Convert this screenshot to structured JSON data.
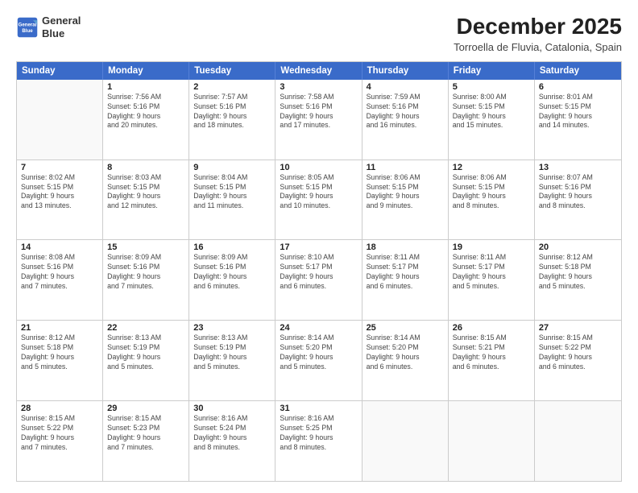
{
  "logo": {
    "line1": "General",
    "line2": "Blue"
  },
  "title": "December 2025",
  "subtitle": "Torroella de Fluvia, Catalonia, Spain",
  "header_days": [
    "Sunday",
    "Monday",
    "Tuesday",
    "Wednesday",
    "Thursday",
    "Friday",
    "Saturday"
  ],
  "weeks": [
    [
      {
        "day": "",
        "info": ""
      },
      {
        "day": "1",
        "info": "Sunrise: 7:56 AM\nSunset: 5:16 PM\nDaylight: 9 hours\nand 20 minutes."
      },
      {
        "day": "2",
        "info": "Sunrise: 7:57 AM\nSunset: 5:16 PM\nDaylight: 9 hours\nand 18 minutes."
      },
      {
        "day": "3",
        "info": "Sunrise: 7:58 AM\nSunset: 5:16 PM\nDaylight: 9 hours\nand 17 minutes."
      },
      {
        "day": "4",
        "info": "Sunrise: 7:59 AM\nSunset: 5:16 PM\nDaylight: 9 hours\nand 16 minutes."
      },
      {
        "day": "5",
        "info": "Sunrise: 8:00 AM\nSunset: 5:15 PM\nDaylight: 9 hours\nand 15 minutes."
      },
      {
        "day": "6",
        "info": "Sunrise: 8:01 AM\nSunset: 5:15 PM\nDaylight: 9 hours\nand 14 minutes."
      }
    ],
    [
      {
        "day": "7",
        "info": "Sunrise: 8:02 AM\nSunset: 5:15 PM\nDaylight: 9 hours\nand 13 minutes."
      },
      {
        "day": "8",
        "info": "Sunrise: 8:03 AM\nSunset: 5:15 PM\nDaylight: 9 hours\nand 12 minutes."
      },
      {
        "day": "9",
        "info": "Sunrise: 8:04 AM\nSunset: 5:15 PM\nDaylight: 9 hours\nand 11 minutes."
      },
      {
        "day": "10",
        "info": "Sunrise: 8:05 AM\nSunset: 5:15 PM\nDaylight: 9 hours\nand 10 minutes."
      },
      {
        "day": "11",
        "info": "Sunrise: 8:06 AM\nSunset: 5:15 PM\nDaylight: 9 hours\nand 9 minutes."
      },
      {
        "day": "12",
        "info": "Sunrise: 8:06 AM\nSunset: 5:15 PM\nDaylight: 9 hours\nand 8 minutes."
      },
      {
        "day": "13",
        "info": "Sunrise: 8:07 AM\nSunset: 5:16 PM\nDaylight: 9 hours\nand 8 minutes."
      }
    ],
    [
      {
        "day": "14",
        "info": "Sunrise: 8:08 AM\nSunset: 5:16 PM\nDaylight: 9 hours\nand 7 minutes."
      },
      {
        "day": "15",
        "info": "Sunrise: 8:09 AM\nSunset: 5:16 PM\nDaylight: 9 hours\nand 7 minutes."
      },
      {
        "day": "16",
        "info": "Sunrise: 8:09 AM\nSunset: 5:16 PM\nDaylight: 9 hours\nand 6 minutes."
      },
      {
        "day": "17",
        "info": "Sunrise: 8:10 AM\nSunset: 5:17 PM\nDaylight: 9 hours\nand 6 minutes."
      },
      {
        "day": "18",
        "info": "Sunrise: 8:11 AM\nSunset: 5:17 PM\nDaylight: 9 hours\nand 6 minutes."
      },
      {
        "day": "19",
        "info": "Sunrise: 8:11 AM\nSunset: 5:17 PM\nDaylight: 9 hours\nand 5 minutes."
      },
      {
        "day": "20",
        "info": "Sunrise: 8:12 AM\nSunset: 5:18 PM\nDaylight: 9 hours\nand 5 minutes."
      }
    ],
    [
      {
        "day": "21",
        "info": "Sunrise: 8:12 AM\nSunset: 5:18 PM\nDaylight: 9 hours\nand 5 minutes."
      },
      {
        "day": "22",
        "info": "Sunrise: 8:13 AM\nSunset: 5:19 PM\nDaylight: 9 hours\nand 5 minutes."
      },
      {
        "day": "23",
        "info": "Sunrise: 8:13 AM\nSunset: 5:19 PM\nDaylight: 9 hours\nand 5 minutes."
      },
      {
        "day": "24",
        "info": "Sunrise: 8:14 AM\nSunset: 5:20 PM\nDaylight: 9 hours\nand 5 minutes."
      },
      {
        "day": "25",
        "info": "Sunrise: 8:14 AM\nSunset: 5:20 PM\nDaylight: 9 hours\nand 6 minutes."
      },
      {
        "day": "26",
        "info": "Sunrise: 8:15 AM\nSunset: 5:21 PM\nDaylight: 9 hours\nand 6 minutes."
      },
      {
        "day": "27",
        "info": "Sunrise: 8:15 AM\nSunset: 5:22 PM\nDaylight: 9 hours\nand 6 minutes."
      }
    ],
    [
      {
        "day": "28",
        "info": "Sunrise: 8:15 AM\nSunset: 5:22 PM\nDaylight: 9 hours\nand 7 minutes."
      },
      {
        "day": "29",
        "info": "Sunrise: 8:15 AM\nSunset: 5:23 PM\nDaylight: 9 hours\nand 7 minutes."
      },
      {
        "day": "30",
        "info": "Sunrise: 8:16 AM\nSunset: 5:24 PM\nDaylight: 9 hours\nand 8 minutes."
      },
      {
        "day": "31",
        "info": "Sunrise: 8:16 AM\nSunset: 5:25 PM\nDaylight: 9 hours\nand 8 minutes."
      },
      {
        "day": "",
        "info": ""
      },
      {
        "day": "",
        "info": ""
      },
      {
        "day": "",
        "info": ""
      }
    ]
  ]
}
